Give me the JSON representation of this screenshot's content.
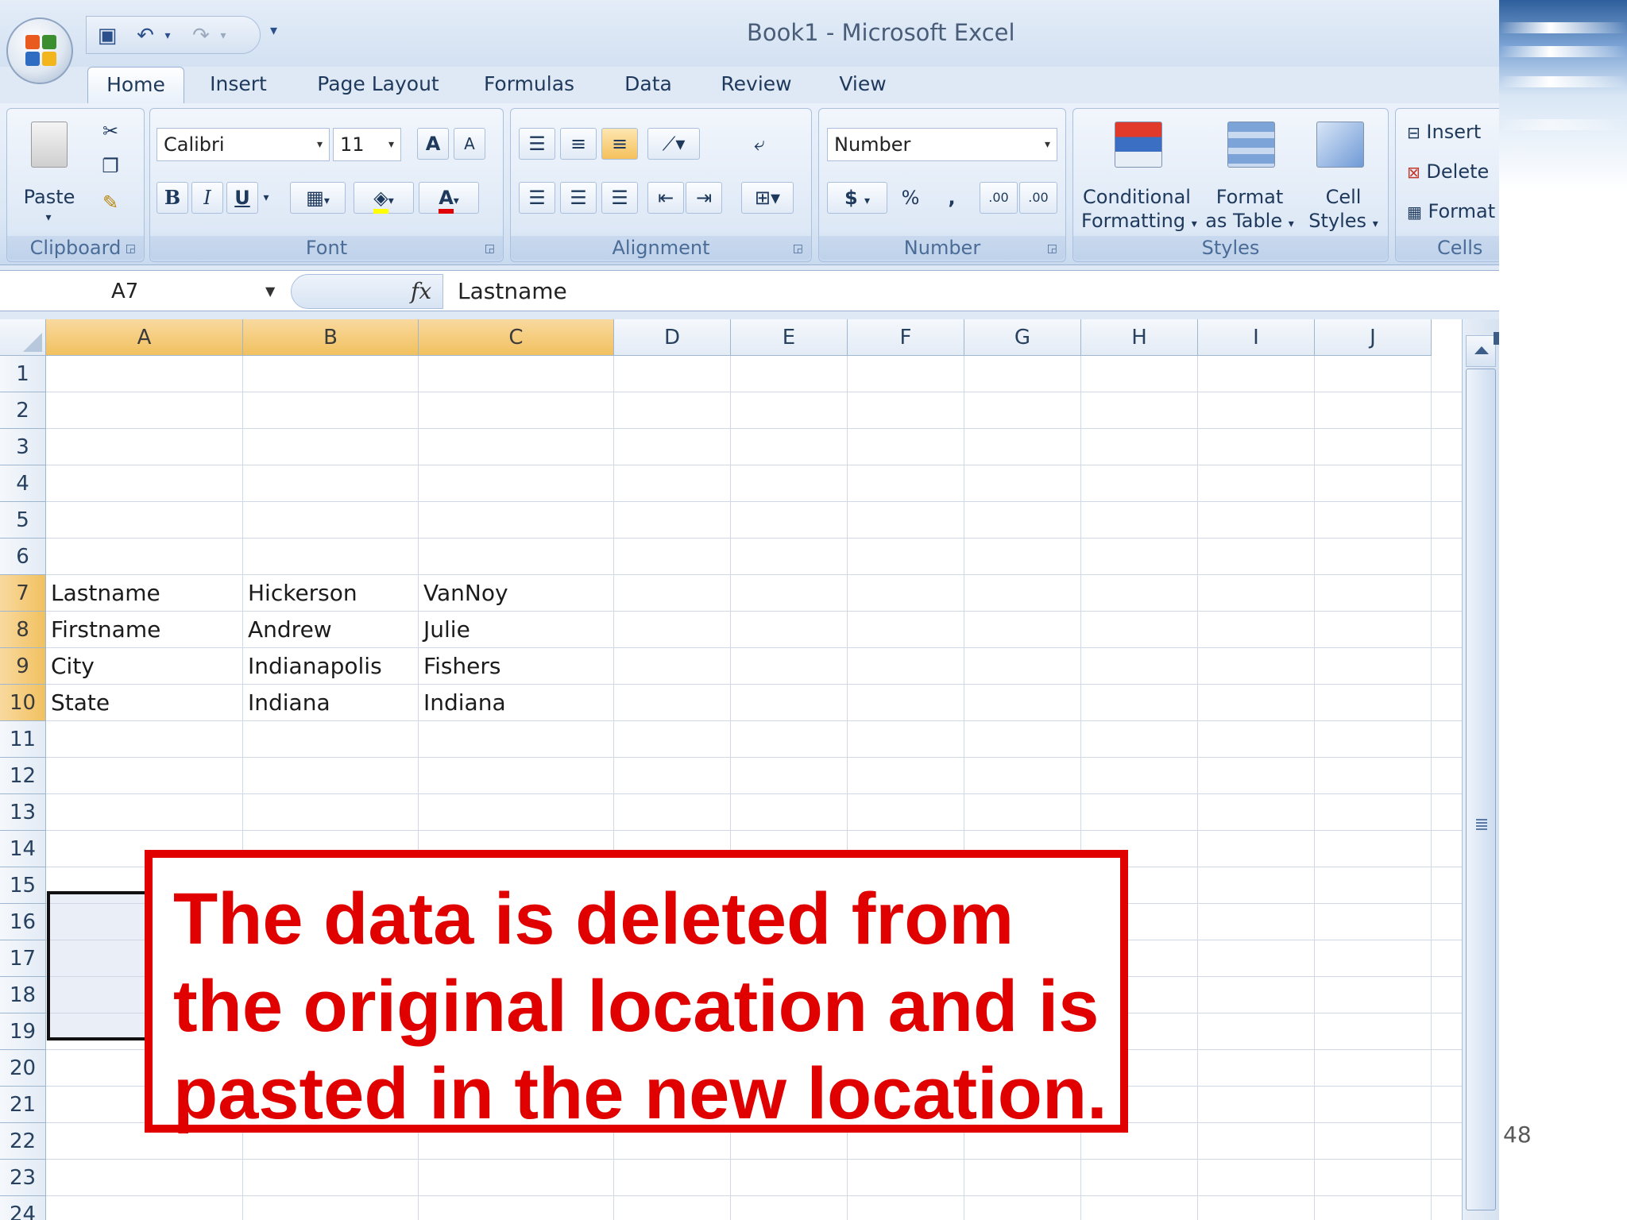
{
  "window": {
    "title": "Book1  -  Microsoft Excel"
  },
  "tabs": [
    "Home",
    "Insert",
    "Page Layout",
    "Formulas",
    "Data",
    "Review",
    "View"
  ],
  "ribbon": {
    "clipboard": {
      "label": "Clipboard",
      "paste": "Paste"
    },
    "font": {
      "label": "Font",
      "family": "Calibri",
      "size": "11",
      "bold": "B",
      "italic": "I",
      "underline": "U",
      "grow": "A",
      "shrink": "A",
      "color_letter": "A"
    },
    "alignment": {
      "label": "Alignment"
    },
    "number": {
      "label": "Number",
      "format": "Number",
      "currency": "$",
      "percent": "%",
      "comma": ",",
      "inc_decimal": ".00",
      "dec_decimal": ".00"
    },
    "styles": {
      "label": "Styles",
      "conditional_line1": "Conditional",
      "conditional_line2": "Formatting",
      "format_table_line1": "Format",
      "format_table_line2": "as Table",
      "cell_styles_line1": "Cell",
      "cell_styles_line2": "Styles"
    },
    "cells": {
      "label": "Cells",
      "insert": "Insert",
      "delete": "Delete",
      "format": "Format"
    }
  },
  "formula_bar": {
    "name_box": "A7",
    "fx": "fx",
    "content": "Lastname"
  },
  "sheet": {
    "columns": [
      "A",
      "B",
      "C",
      "D",
      "E",
      "F",
      "G",
      "H",
      "I",
      "J"
    ],
    "rows": [
      "1",
      "2",
      "3",
      "4",
      "5",
      "6",
      "7",
      "8",
      "9",
      "10",
      "11",
      "12",
      "13",
      "14",
      "15",
      "16",
      "17",
      "18",
      "19",
      "20",
      "21",
      "22",
      "23",
      "24"
    ],
    "cells": {
      "A7": "Lastname",
      "B7": "Hickerson",
      "C7": "VanNoy",
      "A8": "Firstname",
      "B8": "Andrew",
      "C8": "Julie",
      "A9": "City",
      "B9": "Indianapolis",
      "C9": "Fishers",
      "A10": "State",
      "B10": "Indiana",
      "C10": "Indiana"
    }
  },
  "callout": {
    "text": "The data is deleted from\nthe original location and is\npasted in the new location."
  },
  "slide_number": "48",
  "colors": {
    "callout_red": "#e00000",
    "selected_header": "#f1c15f",
    "ribbon_blue": "#dbe7f5"
  }
}
